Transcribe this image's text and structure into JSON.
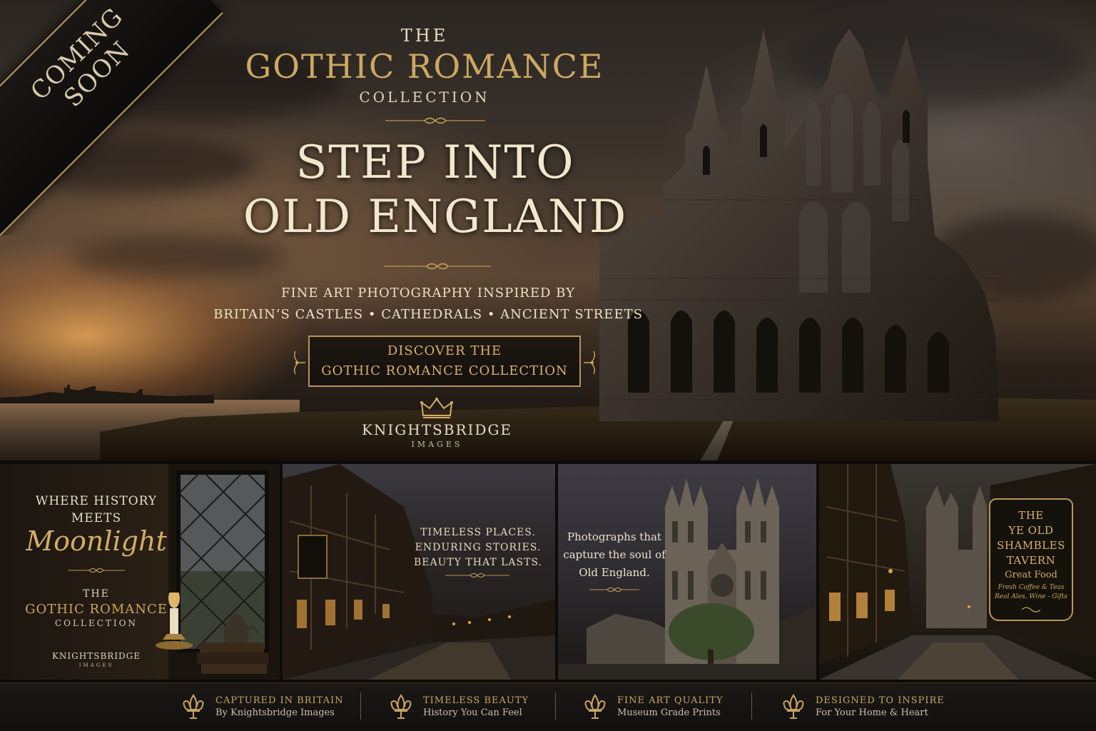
{
  "ribbon": {
    "line1": "COMING",
    "line2": "SOON"
  },
  "hero": {
    "the": "THE",
    "gothic_romance": "GOTHIC ROMANCE",
    "collection": "COLLECTION",
    "headline_line1": "STEP INTO",
    "headline_line2": "OLD ENGLAND",
    "subline1": "FINE ART PHOTOGRAPHY INSPIRED BY",
    "subline2": "BRITAIN’S CASTLES • CATHEDRALS • ANCIENT STREETS",
    "cta_line1": "DISCOVER THE",
    "cta_line2": "GOTHIC ROMANCE COLLECTION",
    "brand": "KNIGHTSBRIDGE",
    "brand_sub": "IMAGES"
  },
  "panel1": {
    "where_line1": "WHERE HISTORY",
    "where_line2": "MEETS",
    "moonlight": "Moonlight",
    "the": "THE",
    "gothic_romance": "GOTHIC ROMANCE",
    "collection": "COLLECTION",
    "brand": "KNIGHTSBRIDGE",
    "brand_sub": "IMAGES"
  },
  "panel2": {
    "line1": "TIMELESS PLACES.",
    "line2": "ENDURING STORIES.",
    "line3": "BEAUTY THAT LASTS."
  },
  "panel3": {
    "line1": "Photographs that",
    "line2": "capture the soul of",
    "line3": "Old England."
  },
  "panel4": {
    "sign_line1": "THE",
    "sign_line2": "YE OLD",
    "sign_line3": "SHAMBLES",
    "sign_line4": "TAVERN",
    "sign_line5": "Great Food",
    "sign_line6": "Fresh Coffee & Teas",
    "sign_line7": "Real Ales, Wine - Gifts"
  },
  "footer": {
    "items": [
      {
        "title": "CAPTURED IN BRITAIN",
        "subtitle": "By Knightsbridge Images",
        "icon": "fleur-de-lis-icon"
      },
      {
        "title": "TIMELESS BEAUTY",
        "subtitle": "History You Can Feel",
        "icon": "fleur-de-lis-icon"
      },
      {
        "title": "FINE ART QUALITY",
        "subtitle": "Museum Grade Prints",
        "icon": "fleur-de-lis-icon"
      },
      {
        "title": "DESIGNED TO INSPIRE",
        "subtitle": "For Your Home & Heart",
        "icon": "fleur-de-lis-icon"
      }
    ]
  },
  "colors": {
    "gold": "#cda863",
    "cream": "#efe3c8",
    "dark": "#0d0b09"
  }
}
